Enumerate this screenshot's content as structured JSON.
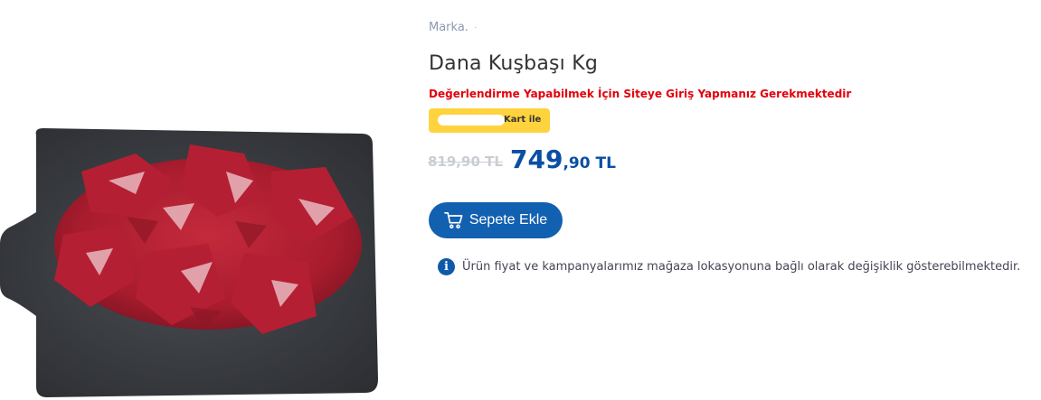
{
  "product": {
    "brand": "Marka.",
    "brand_suffix": "·",
    "title": "Dana Kuşbaşı Kg",
    "login_warning": "Değerlendirme Yapabilmek İçin Siteye Giriş Yapmanız Gerekmektedir",
    "card_badge_label": "Kart ile",
    "old_price": "819,90 TL",
    "new_price_int": "749",
    "new_price_dec": ",90 TL",
    "image_icon": "product-photo-beef-cubes"
  },
  "actions": {
    "add_to_cart_label": "Sepete Ekle",
    "cart_icon": "shopping-cart-icon"
  },
  "notice": {
    "icon": "info-icon",
    "text": "Ürün fiyat ve kampanyalarımız mağaza lokasyonuna bağlı olarak değişiklik gösterebilmektedir."
  },
  "colors": {
    "brand_blue": "#1260b0",
    "price_blue": "#0a4fa3",
    "warning_red": "#e3000b",
    "badge_yellow": "#ffd33d"
  }
}
